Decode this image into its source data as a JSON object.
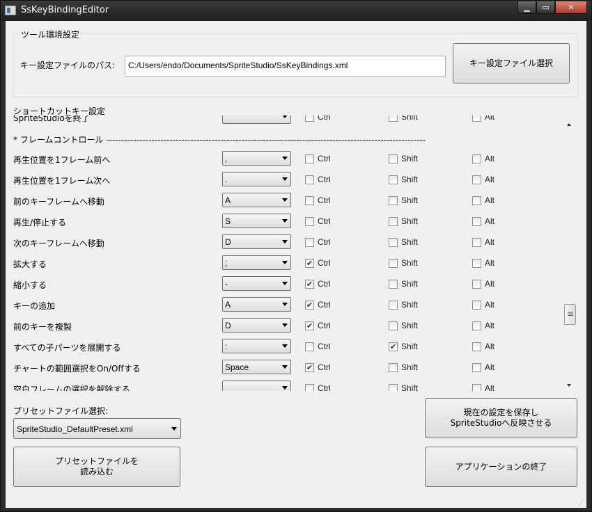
{
  "window": {
    "title": "SsKeyBindingEditor"
  },
  "tool_settings": {
    "group_title": "ツール環境設定",
    "path_label": "キー設定ファイルのパス:",
    "path_value": "C:/Users/endo/Documents/SpriteStudio/SsKeyBindings.xml",
    "select_button": "キー設定ファイル選択"
  },
  "shortcut": {
    "title": "ショートカットキー設定",
    "partial_top_label": "SpriteStudioを終了",
    "section_header": "* フレームコントロール ----------------------------------------------------------------------------------------------------------",
    "ctrl_label": "Ctrl",
    "shift_label": "Shift",
    "alt_label": "Alt",
    "rows": [
      {
        "label": "再生位置を1フレーム前へ",
        "key": ",",
        "ctrl": false,
        "shift": false,
        "alt": false
      },
      {
        "label": "再生位置を1フレーム次へ",
        "key": ".",
        "ctrl": false,
        "shift": false,
        "alt": false
      },
      {
        "label": "前のキーフレームへ移動",
        "key": "A",
        "ctrl": false,
        "shift": false,
        "alt": false
      },
      {
        "label": "再生/停止する",
        "key": "S",
        "ctrl": false,
        "shift": false,
        "alt": false
      },
      {
        "label": "次のキーフレームへ移動",
        "key": "D",
        "ctrl": false,
        "shift": false,
        "alt": false
      },
      {
        "label": "拡大する",
        "key": ";",
        "ctrl": true,
        "shift": false,
        "alt": false
      },
      {
        "label": "縮小する",
        "key": "-",
        "ctrl": true,
        "shift": false,
        "alt": false
      },
      {
        "label": "キーの追加",
        "key": "A",
        "ctrl": true,
        "shift": false,
        "alt": false
      },
      {
        "label": "前のキーを複製",
        "key": "D",
        "ctrl": true,
        "shift": false,
        "alt": false
      },
      {
        "label": "すべての子パーツを展開する",
        "key": ":",
        "ctrl": false,
        "shift": true,
        "alt": false
      },
      {
        "label": "チャートの範囲選択をOn/Offする",
        "key": "Space",
        "ctrl": true,
        "shift": false,
        "alt": false
      },
      {
        "label": "空白フレームの選択を解除する",
        "key": "",
        "ctrl": false,
        "shift": false,
        "alt": false
      }
    ]
  },
  "preset": {
    "label": "プリセットファイル選択:",
    "selected": "SpriteStudio_DefaultPreset.xml",
    "load_button_line1": "プリセットファイルを",
    "load_button_line2": "読み込む"
  },
  "actions": {
    "save_line1": "現在の設定を保存し",
    "save_line2": "SpriteStudioへ反映させる",
    "quit": "アプリケーションの終了"
  }
}
